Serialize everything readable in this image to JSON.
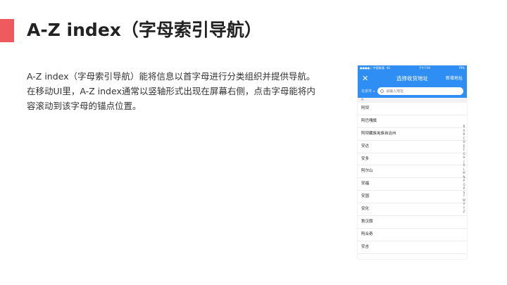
{
  "slide": {
    "title": "A-Z index（字母索引导航）",
    "description": "A-Z index（字母索引导航）能将信息以首字母进行分类组织并提供导航。在移动UI里，A-Z index通常以竖轴形式出现在屏幕右侧，点击字母能将内容滚动到该字母的锚点位置。",
    "accent_color": "#ee5a5e"
  },
  "phone": {
    "status": {
      "carrier": "●●●●○ 中国联通",
      "network": "4G",
      "time": "下午7:04",
      "battery": "79%"
    },
    "nav": {
      "close_icon": "close-icon",
      "title": "选择收货地址",
      "action": "新增地址"
    },
    "search": {
      "city": "北京市",
      "placeholder": "请输入地址"
    },
    "section": "A",
    "items": [
      "阿坝",
      "阿巴嘎旗",
      "阿坝藏族羌族自治州",
      "安达",
      "安多",
      "阿尔山",
      "安福",
      "安国",
      "安化",
      "敖汉旗",
      "阿合奇",
      "安吉"
    ],
    "index_letters": [
      "B",
      "A",
      "B",
      "C",
      "D",
      "E",
      "F",
      "G",
      "H",
      "J",
      "K",
      "L",
      "M",
      "N",
      "P",
      "Q",
      "R",
      "S",
      "T",
      "W",
      "X",
      "Y",
      "Z"
    ],
    "brand_color": "#2e8ef3"
  }
}
